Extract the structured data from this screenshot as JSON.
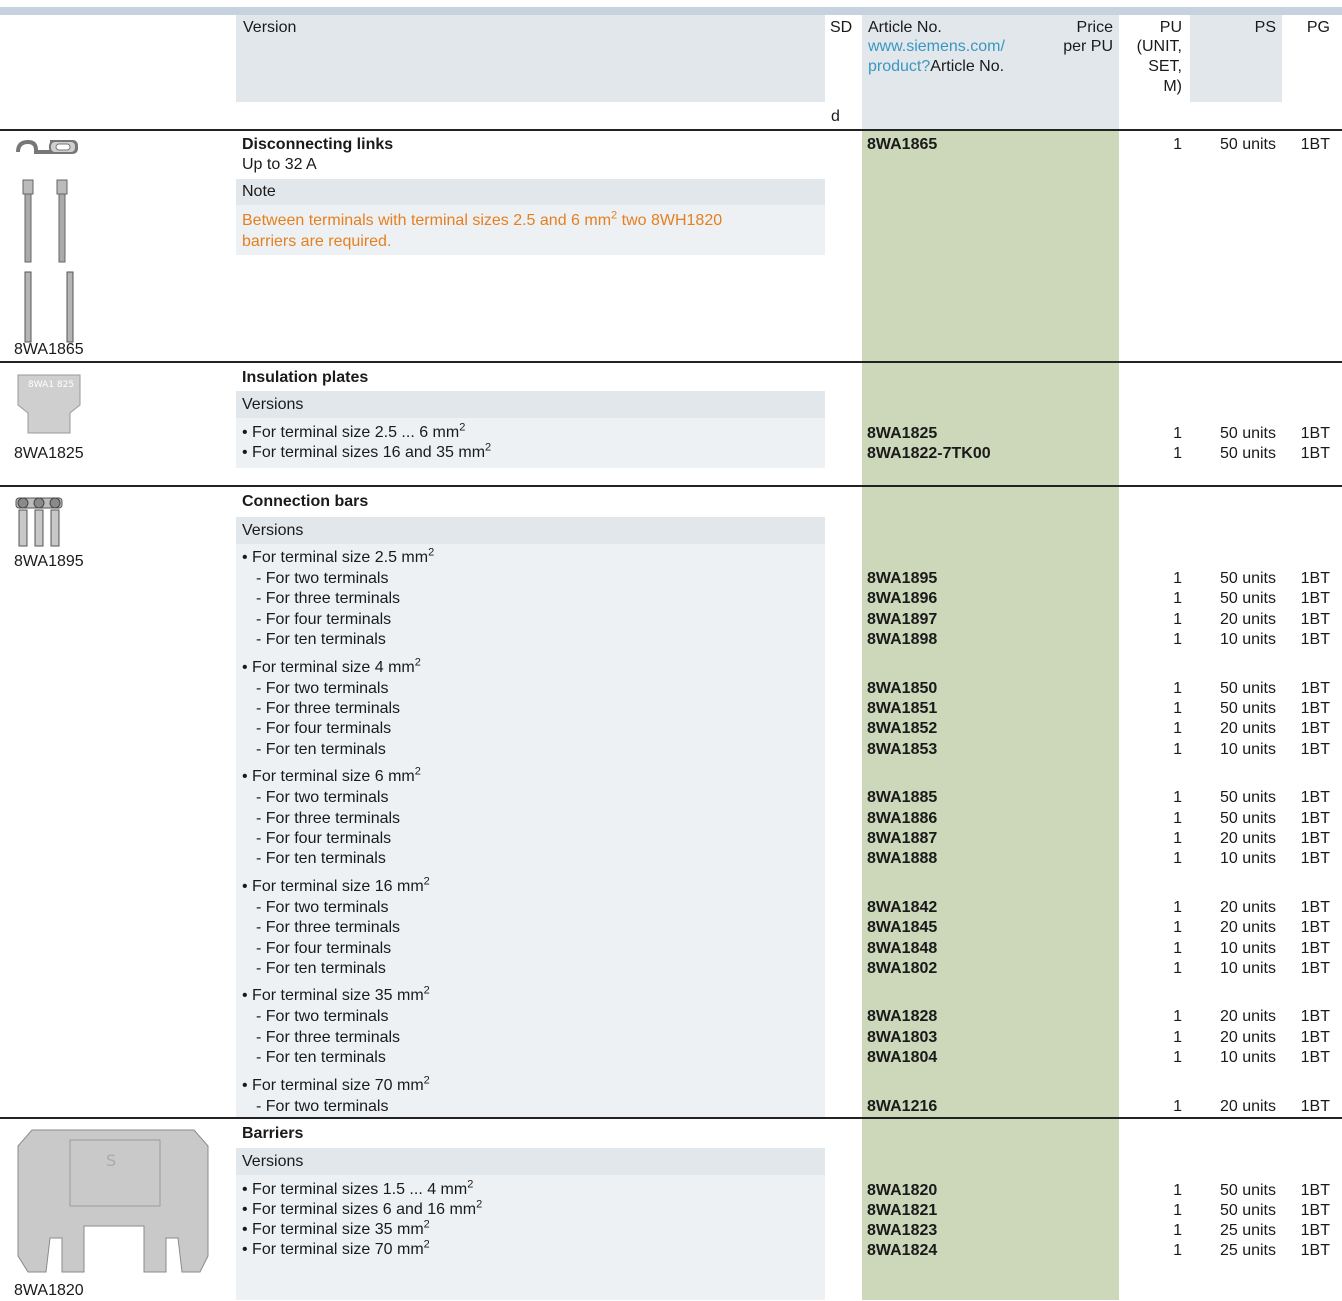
{
  "header": {
    "version": "Version",
    "sd": "SD",
    "d": "d",
    "article_no": "Article No.",
    "article_link1": "www.siemens.com/",
    "article_link2": "product?",
    "article_link3": "Article No.",
    "price1": "Price",
    "price2": "per PU",
    "pu1": "PU",
    "pu2": "(UNIT,",
    "pu3": "SET,",
    "pu4": "M)",
    "ps": "PS",
    "pg": "PG"
  },
  "sections": {
    "disconnecting": {
      "title": "Disconnecting links",
      "subtitle": "Up to 32 A",
      "note_label": "Note",
      "note_text_a": "Between terminals with terminal sizes 2.5 and 6 mm",
      "note_sup": "2",
      "note_text_b": " two 8WH1820",
      "note_text_c": "barriers are required.",
      "article": "8WA1865",
      "pu": "1",
      "ps": "50 units",
      "pg": "1BT",
      "image_label": "8WA1865"
    },
    "insulation": {
      "title": "Insulation plates",
      "versions_label": "Versions",
      "image_label": "8WA1825",
      "rows": [
        {
          "text": "• For terminal size 2.5 ... 6 mm",
          "sup": "2",
          "article": "8WA1825",
          "pu": "1",
          "ps": "50 units",
          "pg": "1BT"
        },
        {
          "text": "• For terminal sizes 16 and 35 mm",
          "sup": "2",
          "article": "8WA1822-7TK00",
          "pu": "1",
          "ps": "50 units",
          "pg": "1BT"
        }
      ]
    },
    "connection": {
      "title": "Connection bars",
      "versions_label": "Versions",
      "image_label": "8WA1895",
      "groups": [
        {
          "heading": "• For terminal size 2.5 mm",
          "sup": "2",
          "items": [
            {
              "text": "- For two terminals",
              "article": "8WA1895",
              "pu": "1",
              "ps": "50 units",
              "pg": "1BT"
            },
            {
              "text": "- For three terminals",
              "article": "8WA1896",
              "pu": "1",
              "ps": "50 units",
              "pg": "1BT"
            },
            {
              "text": "- For four terminals",
              "article": "8WA1897",
              "pu": "1",
              "ps": "20 units",
              "pg": "1BT"
            },
            {
              "text": "- For ten terminals",
              "article": "8WA1898",
              "pu": "1",
              "ps": "10 units",
              "pg": "1BT"
            }
          ]
        },
        {
          "heading": "• For terminal size 4 mm",
          "sup": "2",
          "items": [
            {
              "text": "- For two terminals",
              "article": "8WA1850",
              "pu": "1",
              "ps": "50 units",
              "pg": "1BT"
            },
            {
              "text": "- For three terminals",
              "article": "8WA1851",
              "pu": "1",
              "ps": "50 units",
              "pg": "1BT"
            },
            {
              "text": "- For four terminals",
              "article": "8WA1852",
              "pu": "1",
              "ps": "20 units",
              "pg": "1BT"
            },
            {
              "text": "- For ten terminals",
              "article": "8WA1853",
              "pu": "1",
              "ps": "10 units",
              "pg": "1BT"
            }
          ]
        },
        {
          "heading": "• For terminal size 6 mm",
          "sup": "2",
          "items": [
            {
              "text": "- For two terminals",
              "article": "8WA1885",
              "pu": "1",
              "ps": "50 units",
              "pg": "1BT"
            },
            {
              "text": "- For three terminals",
              "article": "8WA1886",
              "pu": "1",
              "ps": "50 units",
              "pg": "1BT"
            },
            {
              "text": "- For four terminals",
              "article": "8WA1887",
              "pu": "1",
              "ps": "20 units",
              "pg": "1BT"
            },
            {
              "text": "- For ten terminals",
              "article": "8WA1888",
              "pu": "1",
              "ps": "10 units",
              "pg": "1BT"
            }
          ]
        },
        {
          "heading": "• For terminal size 16 mm",
          "sup": "2",
          "items": [
            {
              "text": "- For two terminals",
              "article": "8WA1842",
              "pu": "1",
              "ps": "20 units",
              "pg": "1BT"
            },
            {
              "text": "- For three terminals",
              "article": "8WA1845",
              "pu": "1",
              "ps": "20 units",
              "pg": "1BT"
            },
            {
              "text": "- For four terminals",
              "article": "8WA1848",
              "pu": "1",
              "ps": "10 units",
              "pg": "1BT"
            },
            {
              "text": "- For ten terminals",
              "article": "8WA1802",
              "pu": "1",
              "ps": "10 units",
              "pg": "1BT"
            }
          ]
        },
        {
          "heading": "• For terminal size 35 mm",
          "sup": "2",
          "items": [
            {
              "text": "- For two terminals",
              "article": "8WA1828",
              "pu": "1",
              "ps": "20 units",
              "pg": "1BT"
            },
            {
              "text": "- For three terminals",
              "article": "8WA1803",
              "pu": "1",
              "ps": "20 units",
              "pg": "1BT"
            },
            {
              "text": "- For ten terminals",
              "article": "8WA1804",
              "pu": "1",
              "ps": "10 units",
              "pg": "1BT"
            }
          ]
        },
        {
          "heading": "• For terminal size 70 mm",
          "sup": "2",
          "items": [
            {
              "text": "- For two terminals",
              "article": "8WA1216",
              "pu": "1",
              "ps": "20 units",
              "pg": "1BT"
            }
          ]
        }
      ]
    },
    "barriers": {
      "title": "Barriers",
      "versions_label": "Versions",
      "image_label": "8WA1820",
      "rows": [
        {
          "text": "• For terminal sizes 1.5 ... 4 mm",
          "sup": "2",
          "article": "8WA1820",
          "pu": "1",
          "ps": "50 units",
          "pg": "1BT"
        },
        {
          "text": "• For terminal sizes 6 and 16 mm",
          "sup": "2",
          "article": "8WA1821",
          "pu": "1",
          "ps": "50 units",
          "pg": "1BT"
        },
        {
          "text": "• For terminal size 35 mm",
          "sup": "2",
          "article": "8WA1823",
          "pu": "1",
          "ps": "25 units",
          "pg": "1BT"
        },
        {
          "text": "• For terminal size 70 mm",
          "sup": "2",
          "article": "8WA1824",
          "pu": "1",
          "ps": "25 units",
          "pg": "1BT"
        }
      ]
    }
  }
}
